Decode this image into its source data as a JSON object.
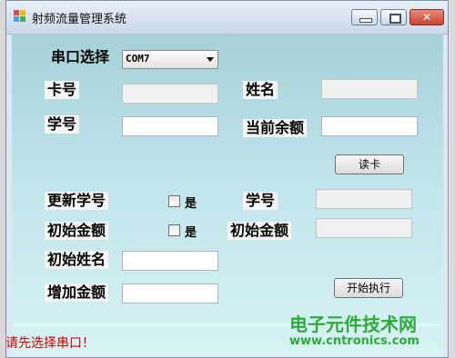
{
  "window": {
    "title": "射频流量管理系统"
  },
  "port": {
    "label": "串口选择",
    "value": "COM7"
  },
  "card": {
    "label": "卡号",
    "value": ""
  },
  "name": {
    "label": "姓名",
    "value": ""
  },
  "student_id": {
    "label": "学号",
    "value": ""
  },
  "balance": {
    "label": "当前余额",
    "value": ""
  },
  "read_button": "读卡",
  "update_id": {
    "label": "更新学号",
    "checkbox_label": "是",
    "right_label": "学号",
    "value": ""
  },
  "init_amount": {
    "label": "初始金额",
    "checkbox_label": "是",
    "right_label": "初始金额",
    "value": ""
  },
  "init_name": {
    "label": "初始姓名",
    "value": ""
  },
  "add_amount": {
    "label": "增加金额",
    "value": ""
  },
  "execute_button": "开始执行",
  "status": "请先选择串口！",
  "watermark": {
    "line1": "电子元件技术网",
    "line2": "www.cntronics.com"
  },
  "colors": {
    "status": "#d00000",
    "watermark": "#2eaa3a",
    "client_bg": "#bfe5ea"
  }
}
